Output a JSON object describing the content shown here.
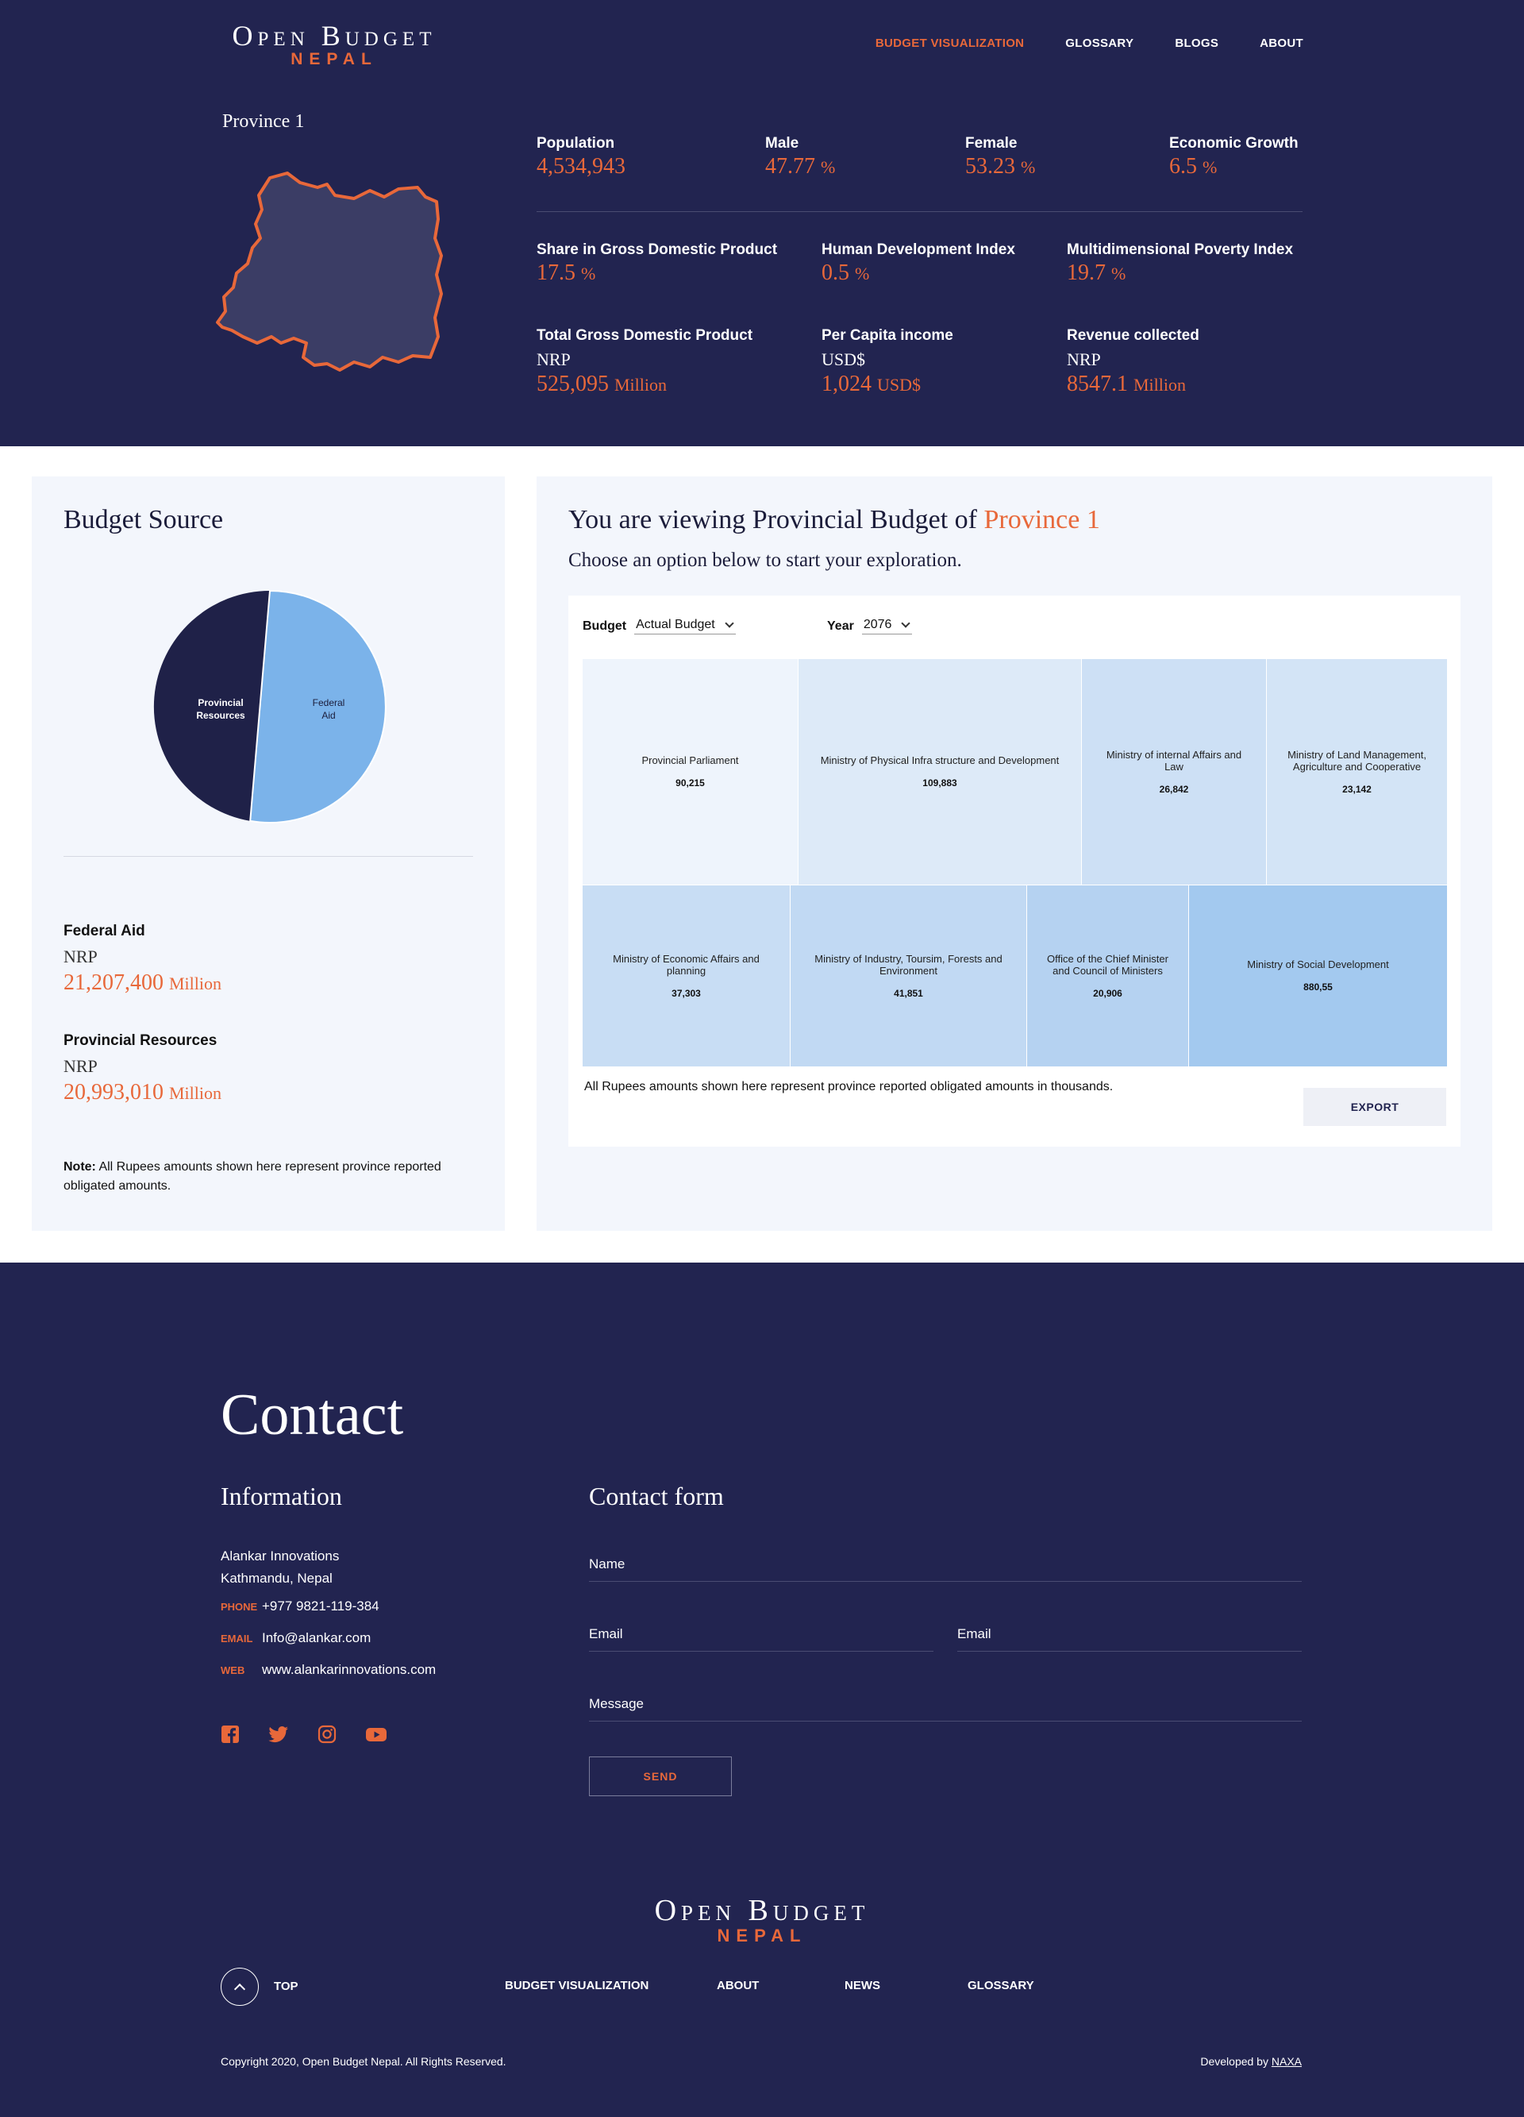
{
  "brand": {
    "line1": "Open Budget",
    "line2": "NEPAL"
  },
  "nav": {
    "items": [
      {
        "label": "BUDGET VISUALIZATION",
        "active": true
      },
      {
        "label": "GLOSSARY",
        "active": false
      },
      {
        "label": "BLOGS",
        "active": false
      },
      {
        "label": "ABOUT",
        "active": false
      }
    ]
  },
  "province": {
    "name": "Province 1",
    "stats": {
      "population": {
        "label": "Population",
        "value": "4,534,943"
      },
      "male": {
        "label": "Male",
        "value": "47.77",
        "unit": "%"
      },
      "female": {
        "label": "Female",
        "value": "53.23",
        "unit": "%"
      },
      "growth": {
        "label": "Economic Growth",
        "value": "6.5",
        "unit": "%"
      },
      "gdp_share": {
        "label": "Share in Gross Domestic Product",
        "value": "17.5",
        "unit": "%"
      },
      "hdi": {
        "label": "Human Development Index",
        "value": "0.5",
        "unit": "%"
      },
      "mpi": {
        "label": "Multidimensional Poverty Index",
        "value": "19.7",
        "unit": "%"
      },
      "total_gdp": {
        "label": "Total Gross Domestic Product",
        "currency": "NRP",
        "value": "525,095",
        "unit": "Million"
      },
      "per_capita": {
        "label": "Per Capita income",
        "currency": "USD$",
        "value": "1,024",
        "unit": "USD$"
      },
      "revenue": {
        "label": "Revenue collected",
        "currency": "NRP",
        "value": "8547.1",
        "unit": "Million"
      }
    }
  },
  "budget_source": {
    "title": "Budget Source",
    "pie_labels": {
      "provincial": [
        "Provincial",
        "Resources"
      ],
      "federal": [
        "Federal",
        "Aid"
      ]
    },
    "colors": {
      "provincial": "#1f2148",
      "federal": "#7bb3ea"
    },
    "federal": {
      "label": "Federal Aid",
      "currency": "NRP",
      "value": "21,207,400",
      "unit": "Million"
    },
    "provincial": {
      "label": "Provincial Resources",
      "currency": "NRP",
      "value": "20,993,010",
      "unit": "Million"
    },
    "note_bold": "Note:",
    "note": " All Rupees amounts shown here represent province reported obligated amounts."
  },
  "viewer": {
    "title_prefix": "You are viewing Provincial Budget of ",
    "title_province": "Province 1",
    "subtitle": "Choose an option below to start your exploration.",
    "budget_label": "Budget",
    "budget_value": "Actual Budget",
    "year_label": "Year",
    "year_value": "2076",
    "note": "All Rupees amounts shown here represent province reported obligated amounts in thousands.",
    "export": "EXPORT"
  },
  "chart_data": {
    "type": "treemap",
    "title": "",
    "items": [
      {
        "name": "Provincial Parliament",
        "label": "90,215",
        "color": "#eef4fc"
      },
      {
        "name": "Ministry of Physical Infra structure and Development",
        "label": "109,883",
        "color": "#ddeaf8"
      },
      {
        "name": "Ministry of internal Affairs and Law",
        "label": "26,842",
        "color": "#cde0f5"
      },
      {
        "name": "Ministry of Land Management, Agriculture and Cooperative",
        "label": "23,142",
        "color": "#d3e4f6"
      },
      {
        "name": "Ministry of Economic Affairs and planning",
        "label": "37,303",
        "color": "#c8ddf4"
      },
      {
        "name": "Ministry of Industry, Toursim, Forests and Environment",
        "label": "41,851",
        "color": "#c1d9f3"
      },
      {
        "name": "Office of the Chief Minister and Council of Ministers",
        "label": "20,906",
        "color": "#b5d2f1"
      },
      {
        "name": "Ministry of Social Development",
        "label": "880,55",
        "color": "#a3c9ef"
      }
    ]
  },
  "contact": {
    "title": "Contact",
    "info_title": "Information",
    "form_title": "Contact form",
    "company": "Alankar Innovations",
    "city": "Kathmandu, Nepal",
    "phone_label": "PHONE",
    "phone": "+977 9821-119-384",
    "email_label": "EMAIL",
    "email": "Info@alankar.com",
    "web_label": "WEB",
    "web": "www.alankarinnovations.com",
    "fields": {
      "name": "Name",
      "email1": "Email",
      "email2": "Email",
      "message": "Message"
    },
    "send": "SEND"
  },
  "footer": {
    "top": "TOP",
    "nav": [
      "BUDGET VISUALIZATION",
      "ABOUT",
      "NEWS",
      "GLOSSARY"
    ],
    "copyright": "Copyright 2020, Open Budget Nepal. All Rights Reserved.",
    "developed_prefix": "Developed by ",
    "developed_by": "NAXA"
  }
}
